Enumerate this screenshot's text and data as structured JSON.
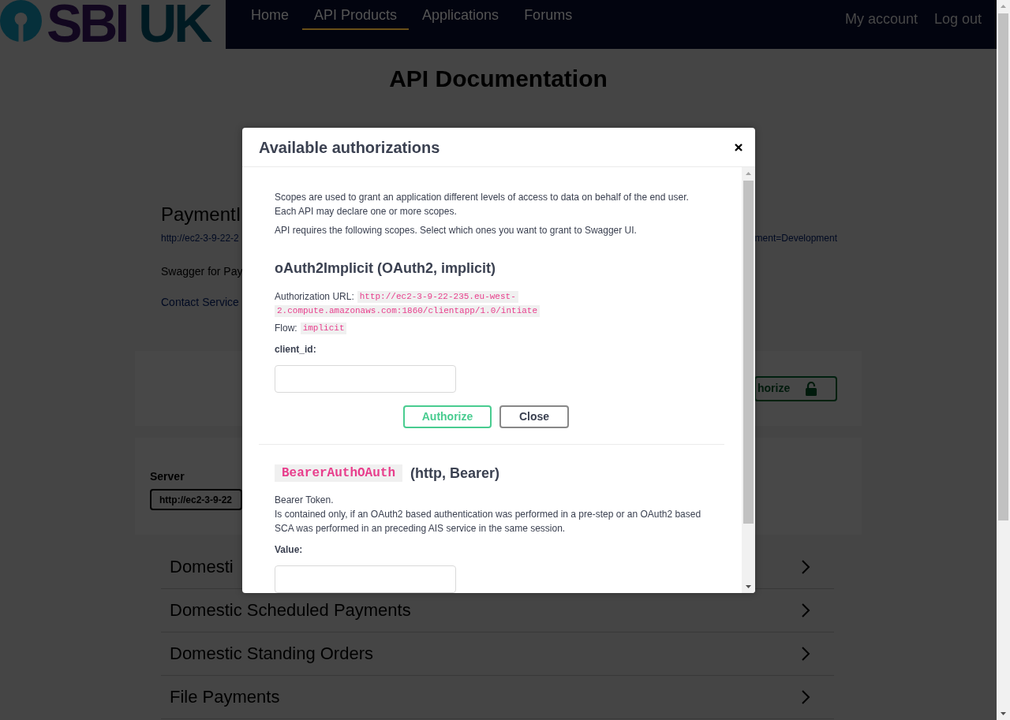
{
  "logo": {
    "text_1": "SBI",
    "text_2": "UK"
  },
  "nav": [
    {
      "label": "Home",
      "selected": false
    },
    {
      "label": "API Products",
      "selected": true
    },
    {
      "label": "Applications",
      "selected": false
    },
    {
      "label": "Forums",
      "selected": false
    }
  ],
  "account_links": [
    "My account",
    "Log out"
  ],
  "page_title": "API Documentation",
  "info": {
    "title": "PaymentI",
    "url_left": "http://ec2-3-9-22-2",
    "url_right": "ment=Development",
    "description": "Swagger for Pay",
    "contact": "Contact Service"
  },
  "authorize_button": {
    "label": "horize"
  },
  "server": {
    "label": "Server",
    "value": "http://ec2-3-9-22"
  },
  "sections": [
    {
      "title": "Domesti"
    },
    {
      "title": "Domestic Scheduled Payments"
    },
    {
      "title": "Domestic Standing Orders"
    },
    {
      "title": "File Payments"
    }
  ],
  "modal": {
    "title": "Available authorizations",
    "intro": "Scopes are used to grant an application different levels of access to data on behalf of the end user. Each API may declare one or more scopes.",
    "scopes_note": "API requires the following scopes. Select which ones you want to grant to Swagger UI.",
    "schemes": [
      {
        "kind": "oauth2",
        "heading": "oAuth2Implicit (OAuth2, implicit)",
        "url_label": "Authorization URL:",
        "url_lines": [
          "http://ec2-3-9-22-235.eu-west-",
          "2.compute.amazonaws.com:1860/clientapp/1.0/intiate"
        ],
        "flow_label": "Flow:",
        "flow": "implicit",
        "field_label": "client_id:",
        "buttons": [
          {
            "kind": "authorize",
            "label": "Authorize"
          },
          {
            "kind": "close",
            "label": "Close"
          }
        ]
      },
      {
        "kind": "bearer",
        "code_name": "BearerAuthOAuth",
        "heading": "(http, Bearer)",
        "description": "Bearer Token.\nIs contained only, if an OAuth2 based authentication was performed in a pre-step or an OAuth2 based SCA was performed in an preceding AIS service in the same session.",
        "field_label": "Value:"
      }
    ]
  }
}
